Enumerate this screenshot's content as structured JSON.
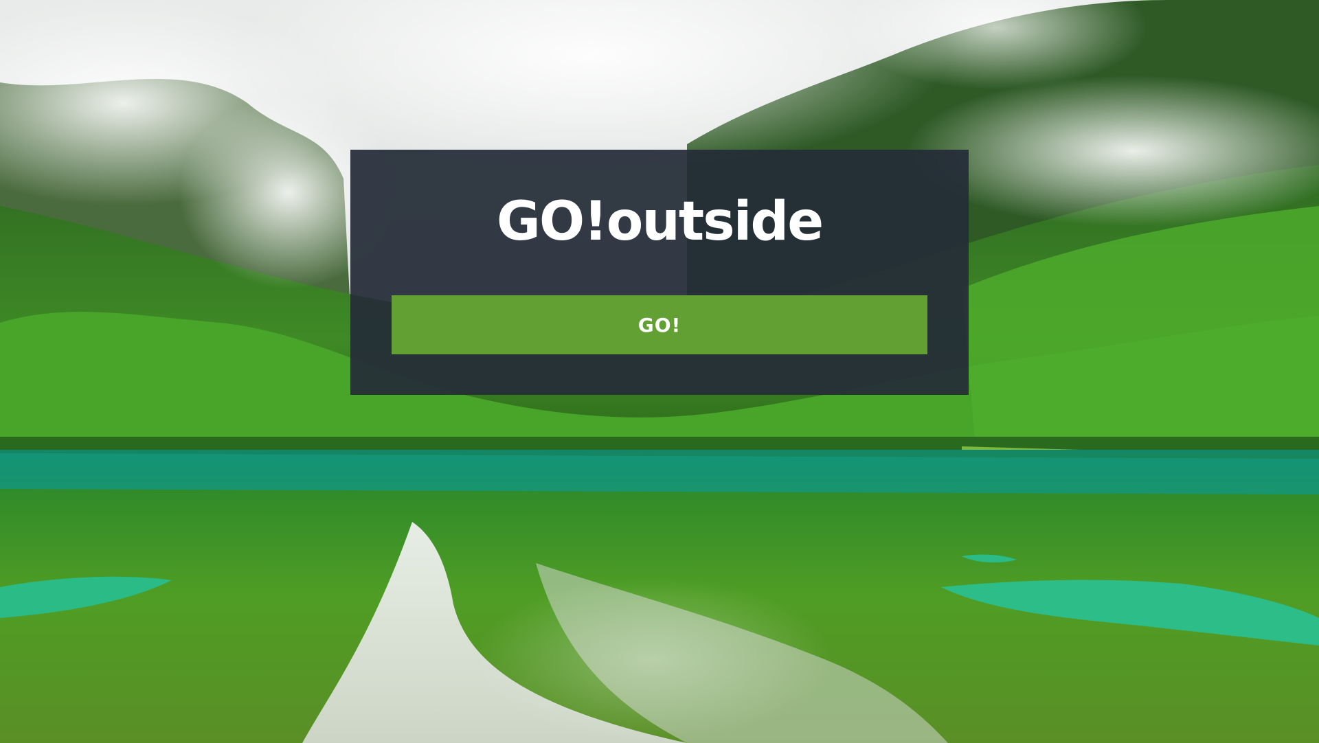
{
  "app": {
    "title": "GO!outside"
  },
  "hero": {
    "button_label": "GO!"
  },
  "colors": {
    "card_background": "#252c38",
    "button_background": "#62a033",
    "text": "#ffffff"
  }
}
